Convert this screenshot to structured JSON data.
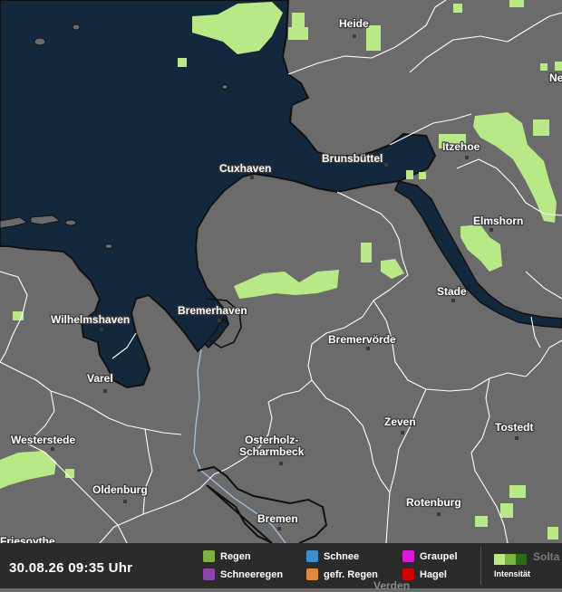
{
  "map": {
    "colors": {
      "land": "#6b6b6b",
      "sea": "#13273d",
      "border": "#ffffff",
      "coast": "#111111",
      "rain_light": "#b8e986"
    },
    "cities": {
      "heide": "Heide",
      "ne": "Ne",
      "itzehoe": "Itzehoe",
      "brunsbuettel": "Brunsbüttel",
      "cuxhaven": "Cuxhaven",
      "elmshorn": "Elmshorn",
      "stade": "Stade",
      "wilhelmshaven": "Wilhelmshaven",
      "bremerhaven": "Bremerhaven",
      "bremervoerde": "Bremervörde",
      "varel": "Varel",
      "zeven": "Zeven",
      "tostedt": "Tostedt",
      "westerstede": "Westerstede",
      "osterholz_1": "Osterholz-",
      "osterholz_2": "Scharmbeck",
      "oldenburg": "Oldenburg",
      "rotenburg": "Rotenburg",
      "bremen": "Bremen",
      "friesoythe": "Friesoythe",
      "verden": "Verden"
    }
  },
  "footer": {
    "timestamp": "30.08.26 09:35 Uhr",
    "legend": [
      {
        "label": "Regen",
        "color": "#7cb342"
      },
      {
        "label": "Schnee",
        "color": "#3d8ec9"
      },
      {
        "label": "Graupel",
        "color": "#d81bd8"
      },
      {
        "label": "Schneeregen",
        "color": "#8e44ad"
      },
      {
        "label": "gefr. Regen",
        "color": "#e08a3c"
      },
      {
        "label": "Hagel",
        "color": "#d50000"
      }
    ],
    "intensity": {
      "label": "Intensität",
      "colors": [
        "#b8e986",
        "#7cb342",
        "#2e6b1e"
      ]
    },
    "cut_label": "Solta"
  }
}
